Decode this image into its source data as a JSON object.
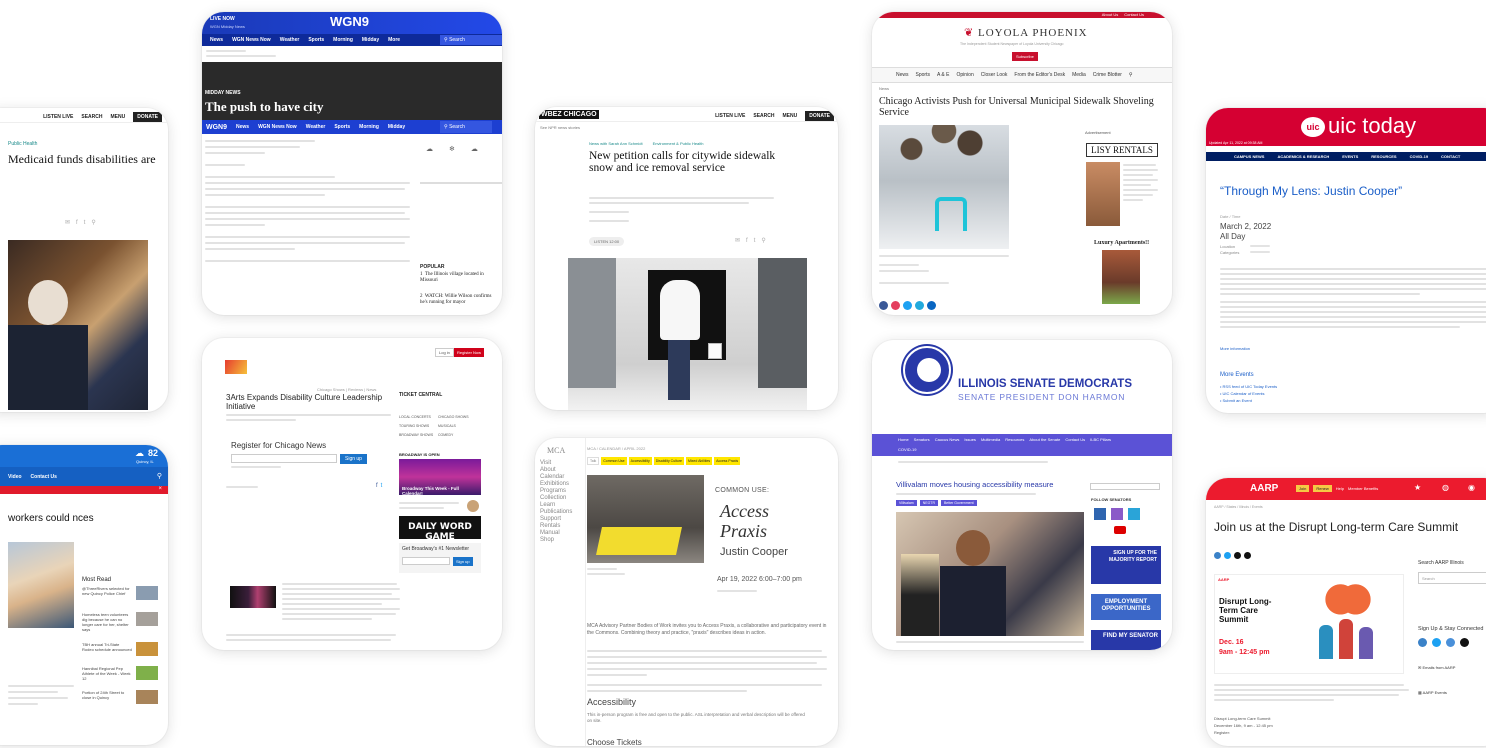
{
  "wbez_left": {
    "top_links": [
      "LISTEN LIVE",
      "SEARCH",
      "MENU",
      "DONATE"
    ],
    "category": "Public Health",
    "headline": "Medicaid funds disabilities are"
  },
  "weather_left": {
    "temp": "82",
    "location": "Quincy, IL",
    "nav": [
      "Video",
      "Contact Us"
    ],
    "headline": "workers could nces",
    "most_read_title": "Most Read",
    "most_read": [
      "@ThreeRivers selected for new Quincy Police Chief",
      "Homeless teen volunteers dig because he can no longer care for her, shelter says",
      "TBH annual Tri-State Rodeo schedule announced",
      "Hannibal Regional Pep Athlete of the Week - Week 12",
      "Portion of 24th Street to close in Quincy"
    ]
  },
  "wgn": {
    "live_label": "LIVE NOW",
    "live_sub": "WGN Midday News",
    "logo": "WGN9",
    "nav": [
      "News",
      "WGN News Now",
      "Weather",
      "Sports",
      "Morning",
      "Midday",
      "More"
    ],
    "search": "Search",
    "show_label": "MIDDAY NEWS",
    "headline": "The push to have city",
    "popular_title": "POPULAR",
    "popular": [
      "The Illinois village located in Missouri",
      "WATCH: Willie Wilson confirms he's running for mayor"
    ]
  },
  "threearts": {
    "login": "Log in",
    "register": "Register Now",
    "breadcrumb": "Chicago Shows | Reviews | News",
    "headline": "3Arts Expands Disability Culture Leadership Initiative",
    "register_title": "Register for Chicago News",
    "signup": "Sign up",
    "ticket_central": "TICKET CENTRAL",
    "ticket_links": [
      "LOCAL CONCERTS",
      "CHICAGO SHOWS",
      "TOURING SHOWS",
      "MUSICALS",
      "BROADWAY SHOWS",
      "COMEDY"
    ],
    "broadway_title": "BROADWAY IS OPEN",
    "broadway_banner": "Broadway This Week - Full Calendar!",
    "daily_game": "DAILY WORD GAME",
    "newsletter_title": "Get Broadway's #1 Newsletter",
    "newsletter_signup": "Sign up"
  },
  "wbez_center": {
    "logo": "WBEZ CHICAGO",
    "sub": "See NPR news stories",
    "top_links": [
      "LISTEN LIVE",
      "SEARCH",
      "MENU",
      "DONATE"
    ],
    "categories": [
      "News with Sarah Ann Schmidt",
      "Environment & Public Health"
    ],
    "headline": "New petition calls for citywide sidewalk snow and ice removal service",
    "listen_label": "LISTEN 12:00"
  },
  "mca": {
    "logo": "MCA",
    "nav": [
      "Visit",
      "About",
      "Calendar",
      "Exhibitions",
      "Programs",
      "Collection",
      "Learn",
      "Publications",
      "Support",
      "Rentals",
      "Manual",
      "Shop"
    ],
    "breadcrumb": "MCA / CALENDAR / APRIL 2022",
    "tags": [
      "Talk",
      "Common Use",
      "Accessibility",
      "Disability Culture",
      "Mixed Abilities",
      "Access Praxis"
    ],
    "kicker": "COMMON USE:",
    "title_line1": "Access",
    "title_line2": "Praxis",
    "author": "Justin Cooper",
    "date": "Apr 19, 2022  6:00–7:00 pm",
    "intro": "MCA Advisory Partner Bodies of Work invites you to Access Praxis, a collaborative and participatory event in the Commons. Combining theory and practice, \"praxis\" describes ideas in action.",
    "section_title": "Accessibility",
    "section_body": "This in-person program is free and open to the public. ASL interpretation and verbal description will be offered on site.",
    "footer_title": "Choose Tickets"
  },
  "loyola": {
    "top_links": [
      "About Us",
      "Contact Us"
    ],
    "logo": "LOYOLA PHOENIX",
    "tagline": "The Independent Student Newspaper of Loyola University Chicago",
    "subscribe": "Subscribe",
    "nav": [
      "News",
      "Sports",
      "A & E",
      "Opinion",
      "Closer Look",
      "From the Editor's Desk",
      "Media",
      "Crime Blotter"
    ],
    "category": "News",
    "headline": "Chicago Activists Push for Universal Municipal Sidewalk Shoveling Service",
    "ad_label": "Advertisement",
    "ad_title": "LISY RENTALS",
    "ad2_title": "Luxury Apartments!!"
  },
  "ilsenate": {
    "title": "ILLINOIS SENATE DEMOCRATS",
    "subtitle": "SENATE PRESIDENT DON HARMON",
    "nav": [
      "Home",
      "Senators",
      "Caucus News",
      "Issues",
      "Multimedia",
      "Resources",
      "About the Senate",
      "Contact Us",
      "ILBC Pillars"
    ],
    "nav2": "COVID-19",
    "headline": "Villivalam moves housing accessibility measure",
    "tags": [
      "Villivalam",
      "NEGTR",
      "Better Government"
    ],
    "follow": "FOLLOW SENATORS",
    "banner1": "SIGN UP FOR THE MAJORITY REPORT",
    "banner2": "EMPLOYMENT OPPORTUNITIES",
    "banner3": "FIND MY SENATOR"
  },
  "uic": {
    "logo": "uic today",
    "date_line": "Updated Apr 11, 2022 at 09:38 AM",
    "nav": [
      "CAMPUS NEWS",
      "ACADEMICS & RESEARCH",
      "EVENTS",
      "RESOURCES",
      "COVID-19",
      "CONTACT"
    ],
    "headline": "“Through My Lens: Justin Cooper”",
    "meta": "Date / Time",
    "date": "March 2, 2022",
    "allday": "All Day",
    "location_label": "Location",
    "categories_label": "Categories",
    "more_info": "More information",
    "more_events": "More Events",
    "events": [
      "RSS feed of UIC Today Events",
      "UIC Calendar of Events",
      "Submit an Event"
    ]
  },
  "aarp": {
    "logo": "AARP",
    "nav": [
      "Join",
      "Renew",
      "Help",
      "Member Benefits"
    ],
    "breadcrumb": "AARP / States / Illinois / Events",
    "headline": "Join us at the Disrupt Long-term Care Summit",
    "search_label": "Search AARP Illinois",
    "search_placeholder": "Search",
    "event_title": "Disrupt Long-Term Care Summit",
    "event_date": "Dec. 16",
    "event_time": "9am - 12:45 pm",
    "signup_title": "Sign Up & Stay Connected",
    "signup_items": [
      "Emails from AARP",
      "AARP Events"
    ],
    "footer_lines": [
      "Disrupt Long-term Care Summit",
      "December 16th, 9 am - 12:45 pm",
      "Register:"
    ]
  },
  "colors": {
    "wgn_blue": "#1d3fd1",
    "wbez_dark": "#222222",
    "loyola_red": "#c8102e",
    "senate_purple": "#5b52d6",
    "uic_red": "#d50032",
    "aarp_red": "#ec1b2e",
    "mca_yellow": "#ffe600"
  }
}
